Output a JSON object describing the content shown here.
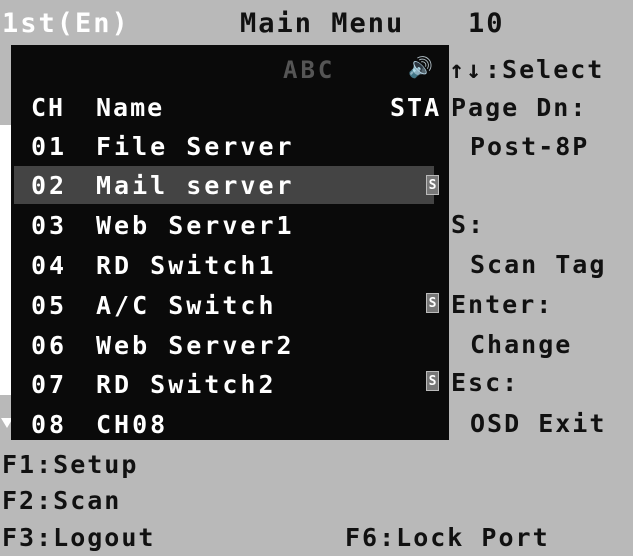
{
  "title_bar": {
    "user": "1st(En)",
    "title": "Main Menu",
    "count": "10"
  },
  "list_panel": {
    "abc_label": "ABC",
    "speaker_icon": "speaker-icon",
    "headers": {
      "ch": "CH",
      "name": "Name",
      "sta": "STA"
    },
    "channels": [
      {
        "ch": "01",
        "name": "File Server",
        "scan": ""
      },
      {
        "ch": "02",
        "name": "Mail server",
        "scan": "S",
        "selected": true
      },
      {
        "ch": "03",
        "name": "Web Server1",
        "scan": ""
      },
      {
        "ch": "04",
        "name": "RD Switch1",
        "scan": ""
      },
      {
        "ch": "05",
        "name": "A/C Switch",
        "scan": "S"
      },
      {
        "ch": "06",
        "name": "Web Server2",
        "scan": ""
      },
      {
        "ch": "07",
        "name": "RD Switch2",
        "scan": "S"
      },
      {
        "ch": "08",
        "name": "CH08",
        "scan": ""
      }
    ]
  },
  "help_panel": {
    "arrows": "↑↓",
    "select": ":Select",
    "page_dn": "Page Dn:",
    "post": "Post-8P",
    "s_key": "S:",
    "scan_tag": "Scan Tag",
    "enter": "Enter:",
    "change": "Change",
    "esc": "Esc:",
    "osd_exit": "OSD Exit"
  },
  "function_keys": {
    "f1": "F1:Setup",
    "f2": "F2:Scan",
    "f3": "F3:Logout",
    "f6": "F6:Lock Port"
  }
}
